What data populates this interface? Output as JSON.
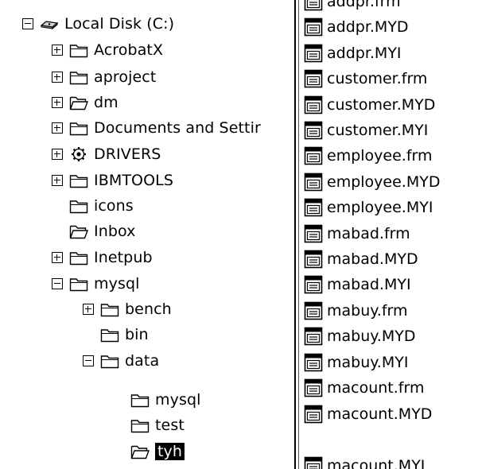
{
  "tree": {
    "root": {
      "label": "Local Disk (C:)",
      "state": "expanded",
      "icon": "drive-icon"
    },
    "nodes": [
      {
        "label": "AcrobatX",
        "state": "collapsed",
        "icon": "folder-icon"
      },
      {
        "label": "aproject",
        "state": "collapsed",
        "icon": "folder-icon"
      },
      {
        "label": "dm",
        "state": "collapsed",
        "icon": "folder-open-icon"
      },
      {
        "label": "Documents and Settir",
        "state": "collapsed",
        "icon": "folder-icon"
      },
      {
        "label": "DRIVERS",
        "state": "collapsed",
        "icon": "gear-icon"
      },
      {
        "label": "IBMTOOLS",
        "state": "collapsed",
        "icon": "folder-icon"
      },
      {
        "label": "icons",
        "state": "none",
        "icon": "folder-icon"
      },
      {
        "label": "Inbox",
        "state": "none",
        "icon": "folder-open-icon"
      },
      {
        "label": "Inetpub",
        "state": "collapsed",
        "icon": "folder-icon"
      },
      {
        "label": "mysql",
        "state": "expanded",
        "icon": "folder-icon"
      },
      {
        "label": "bench",
        "state": "collapsed",
        "icon": "folder-icon"
      },
      {
        "label": "bin",
        "state": "none",
        "icon": "folder-icon"
      },
      {
        "label": "data",
        "state": "expanded",
        "icon": "folder-icon"
      },
      {
        "label": "mysql",
        "state": "none",
        "icon": "folder-icon"
      },
      {
        "label": "test",
        "state": "none",
        "icon": "folder-icon"
      },
      {
        "label": "tyh",
        "state": "none",
        "icon": "folder-open-icon",
        "selected": true
      }
    ]
  },
  "files": [
    {
      "name": "addpr.frm"
    },
    {
      "name": "addpr.MYD"
    },
    {
      "name": "addpr.MYI"
    },
    {
      "name": "customer.frm"
    },
    {
      "name": "customer.MYD"
    },
    {
      "name": "customer.MYI"
    },
    {
      "name": "employee.frm"
    },
    {
      "name": "employee.MYD"
    },
    {
      "name": "employee.MYI"
    },
    {
      "name": "mabad.frm"
    },
    {
      "name": "mabad.MYD"
    },
    {
      "name": "mabad.MYI"
    },
    {
      "name": "mabuy.frm"
    },
    {
      "name": "mabuy.MYD"
    },
    {
      "name": "mabuy.MYI"
    },
    {
      "name": "macount.frm"
    },
    {
      "name": "macount.MYD"
    },
    {
      "name": "macount.MYI"
    }
  ]
}
